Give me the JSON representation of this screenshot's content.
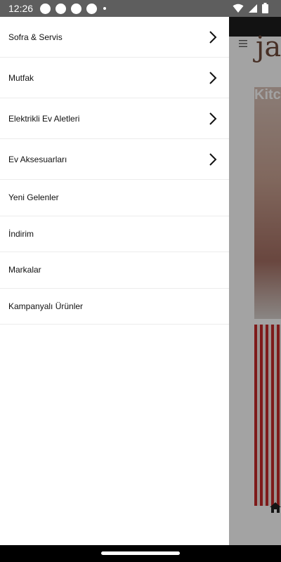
{
  "status_bar": {
    "time": "12:26",
    "icons": [
      "notification-dot-icon",
      "notification-dot-icon",
      "notification-dot-icon",
      "notification-dot-icon",
      "small-dot-icon",
      "wifi-icon",
      "signal-icon",
      "battery-icon"
    ]
  },
  "background_app": {
    "logo": "ja",
    "hero_title": "Kitc",
    "icons": [
      "menu-icon",
      "home-icon"
    ]
  },
  "drawer": {
    "items": [
      {
        "label": "Sofra & Servis",
        "has_chevron": true
      },
      {
        "label": "Mutfak",
        "has_chevron": true
      },
      {
        "label": "Elektrikli Ev Aletleri",
        "has_chevron": true
      },
      {
        "label": "Ev Aksesuarları",
        "has_chevron": true
      },
      {
        "label": "Yeni Gelenler",
        "has_chevron": false
      },
      {
        "label": "İndirim",
        "has_chevron": false
      },
      {
        "label": "Markalar",
        "has_chevron": false
      },
      {
        "label": "Kampanyalı Ürünler",
        "has_chevron": false
      }
    ]
  },
  "colors": {
    "status_bar": "#5e5e5e",
    "scrim": "rgba(0,0,0,0.36)",
    "drawer": "#ffffff",
    "logo": "#6f4a3a"
  }
}
